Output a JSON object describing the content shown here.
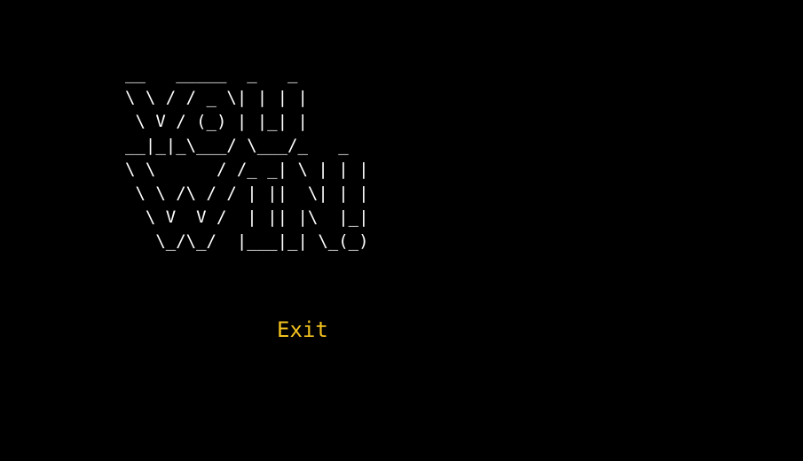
{
  "banner": {
    "ascii_art": "__   _____  _   _ \n\\ \\ / / _ \\| | | |\n \\ V / (_) | |_| |\n__|_|_\\___/ \\___/_   _ \n\\ \\      / /_ _| \\ | | |\n \\ \\ /\\ / / | ||  \\| | |\n  \\ V  V /  | || |\\  |_|\n   \\_/\\_/  |___|_| \\_(_)"
  },
  "menu": {
    "exit_label": "Exit"
  },
  "colors": {
    "background": "#000000",
    "banner_text": "#ffffff",
    "menu_accent": "#f2c11e"
  }
}
